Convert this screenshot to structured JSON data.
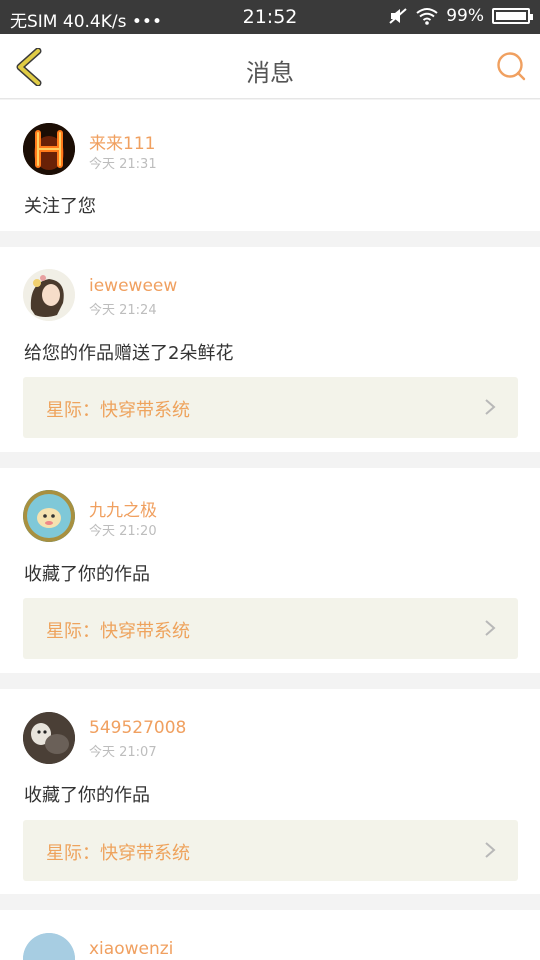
{
  "status_bar": {
    "carrier": "无SIM",
    "speed": "40.4K/s",
    "dots": "•••",
    "time": "21:52",
    "battery": "99%"
  },
  "header": {
    "title": "消息",
    "back_icon": "chevron-left-icon",
    "search_icon": "search-icon"
  },
  "colors": {
    "accent": "#f0a060",
    "back_icon": "#d8c040",
    "work_bg": "#f3f3ea"
  },
  "messages": [
    {
      "user": "来来111",
      "time": "今天 21:31",
      "text": "关注了您"
    },
    {
      "user": "ieweweew",
      "time": "今天 21:24",
      "text": "给您的作品赠送了2朵鲜花",
      "work": "星际：快穿带系统"
    },
    {
      "user": "九九之极",
      "time": "今天 21:20",
      "text": "收藏了你的作品",
      "work": "星际：快穿带系统"
    },
    {
      "user": "549527008",
      "time": "今天 21:07",
      "text": "收藏了你的作品",
      "work": "星际：快穿带系统"
    },
    {
      "user": "xiaowenzi"
    }
  ]
}
